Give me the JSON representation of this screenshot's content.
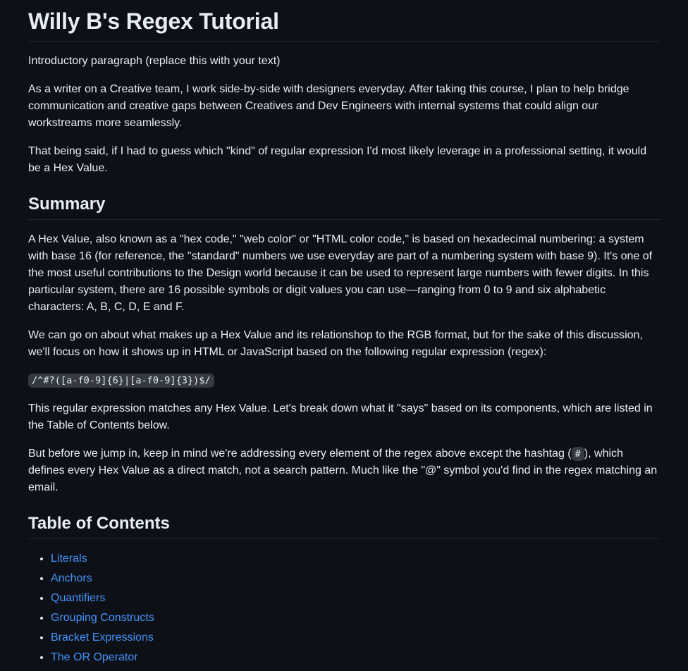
{
  "title": "Willy B's Regex Tutorial",
  "intro": "Introductory paragraph (replace this with your text)",
  "paragraph_1": "As a writer on a Creative team, I work side-by-side with designers everyday. After taking this course, I plan to help bridge communication and creative gaps between Creatives and Dev Engineers with internal systems that could align our workstreams more seamlessly.",
  "paragraph_2": "That being said, if I had to guess which \"kind\" of regular expression I'd most likely leverage in a professional setting, it would be a Hex Value.",
  "summary": {
    "heading": "Summary",
    "p1": "A Hex Value, also known as a \"hex code,\" \"web color\" or \"HTML color code,\" is based on hexadecimal numbering: a system with base 16 (for reference, the \"standard\" numbers we use everyday are part of a numbering system with base 9). It's one of the most useful contributions to the Design world because it can be used to represent large numbers with fewer digits. In this particular system, there are 16 possible symbols or digit values you can use—ranging from 0 to 9 and six alphabetic characters: A, B, C, D, E and F.",
    "p2": "We can go on about what makes up a Hex Value and its relationshop to the RGB format, but for the sake of this discussion, we'll focus on how it shows up in HTML or JavaScript based on the following regular expression (regex):",
    "regex": "/^#?([a-f0-9]{6}|[a-f0-9]{3})$/",
    "p3": "This regular expression matches any Hex Value. Let's break down what it \"says\" based on its components, which are listed in the Table of Contents below.",
    "p4_before": "But before we jump in, keep in mind we're addressing every element of the regex above except the hashtag (",
    "p4_code": "#",
    "p4_after": "), which defines every Hex Value as a direct match, not a search pattern. Much like the \"@\" symbol you'd find in the regex matching an email."
  },
  "toc": {
    "heading": "Table of Contents",
    "items": [
      "Literals",
      "Anchors",
      "Quantifiers",
      "Grouping Constructs",
      "Bracket Expressions",
      "The OR Operator"
    ]
  },
  "colors": {
    "background": "#0d1117",
    "text": "#e6edf3",
    "link": "#4493f8",
    "divider": "#21262d",
    "code_bg": "#343942"
  }
}
